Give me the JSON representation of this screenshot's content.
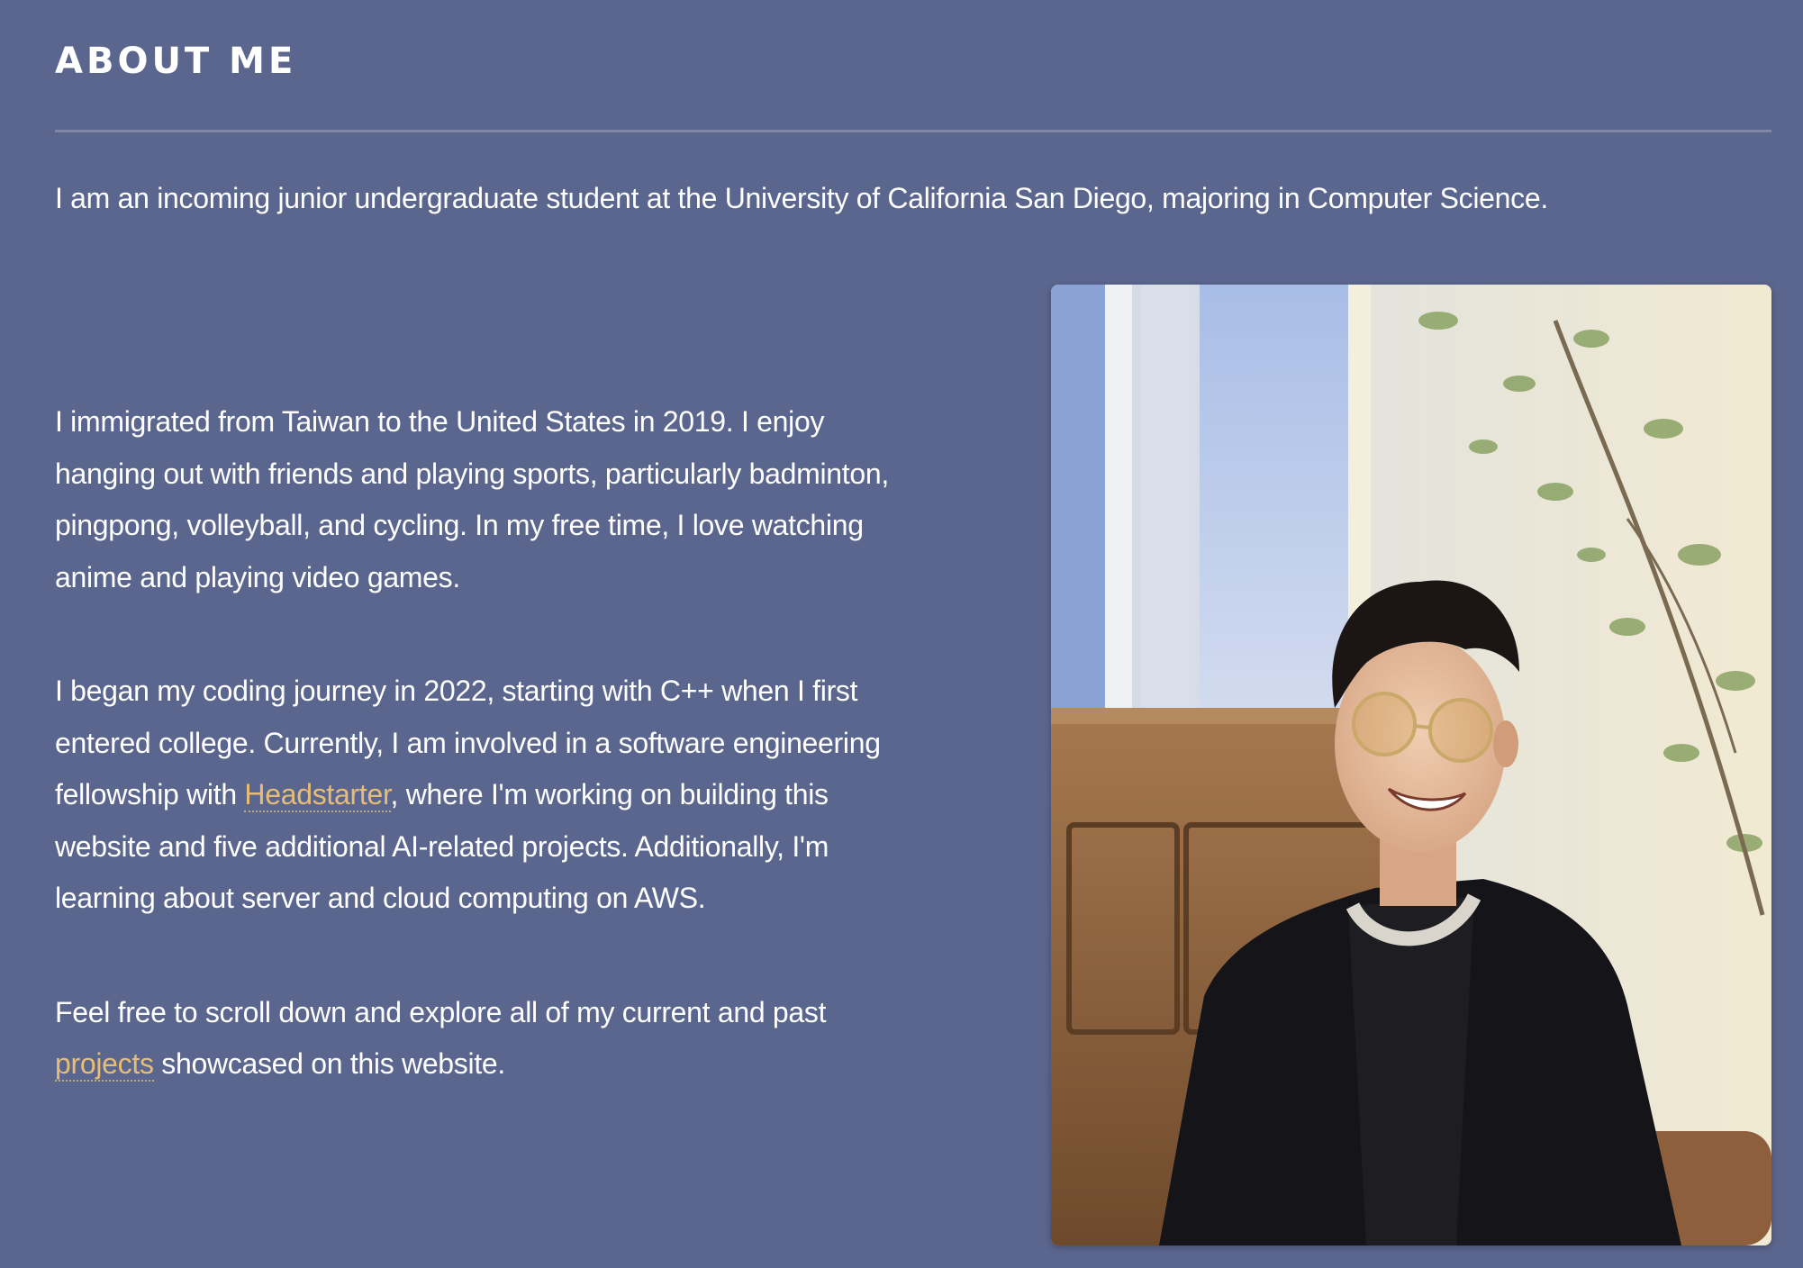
{
  "about": {
    "heading": "ABOUT ME",
    "intro": "I am an incoming junior undergraduate student at the University of California San Diego, majoring in Computer Science.",
    "paragraph1": "I immigrated from Taiwan to the United States in 2019. I enjoy hanging out with friends and playing sports, particularly badminton, pingpong, volleyball, and cycling. In my free time, I love watching anime and playing video games.",
    "paragraph2": {
      "before": "I began my coding journey in 2022, starting with C++ when I first entered college. Currently, I am involved in a software engineering fellowship with ",
      "link": "Headstarter",
      "after": ", where I'm working on building this website and five additional AI-related projects. Additionally, I'm learning about server and cloud computing on AWS."
    },
    "paragraph3": {
      "before": "Feel free to scroll down and explore all of my current and past ",
      "link": "projects",
      "after": " showcased on this website."
    }
  },
  "colors": {
    "background": "#5b668f",
    "text": "#ffffff",
    "link": "#e6bd77"
  }
}
